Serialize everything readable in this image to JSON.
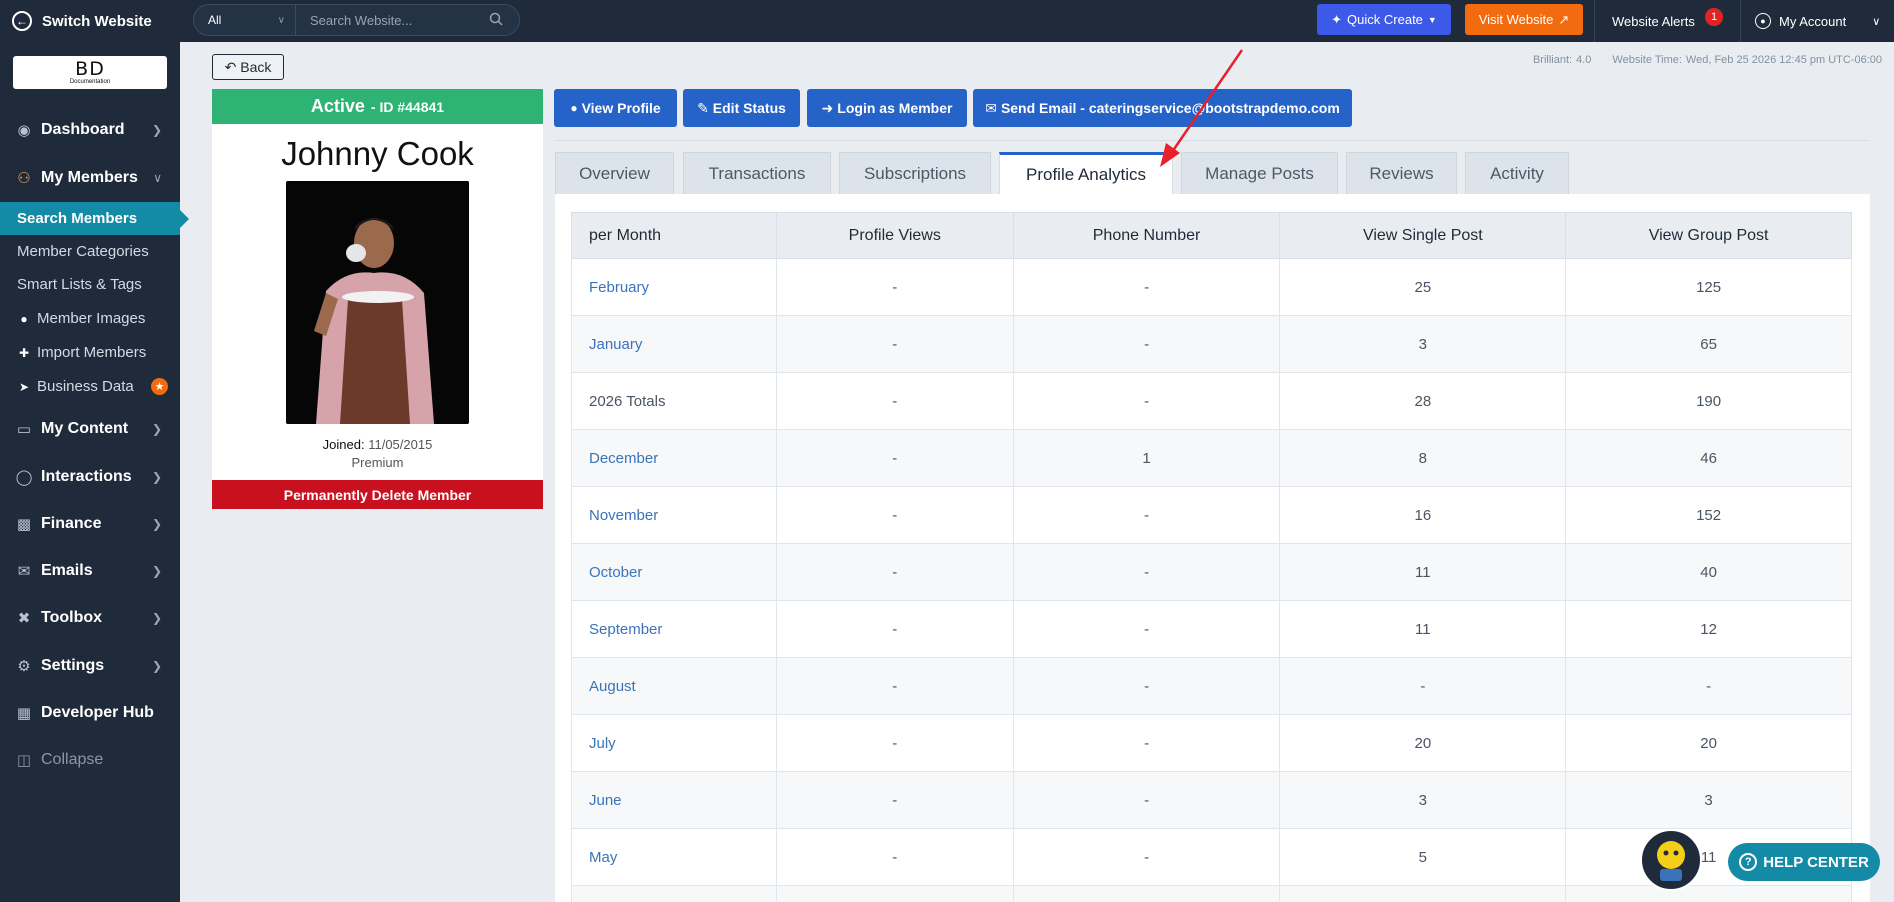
{
  "topbar": {
    "switch_label": "Switch Website",
    "search_scope": "All",
    "search_placeholder": "Search Website...",
    "quick_create": "Quick Create",
    "visit_website": "Visit Website",
    "alerts_label": "Website Alerts",
    "alerts_count": "1",
    "account_label": "My Account"
  },
  "sidebar": {
    "logo_text": "BD",
    "logo_sub": "Documentation",
    "nav": [
      {
        "label": "Dashboard",
        "icon": "speedometer-icon"
      },
      {
        "label": "My Members",
        "icon": "users-icon"
      },
      {
        "label": "My Content",
        "icon": "folder-icon"
      },
      {
        "label": "Interactions",
        "icon": "chat-icon"
      },
      {
        "label": "Finance",
        "icon": "bar-chart-icon"
      },
      {
        "label": "Emails",
        "icon": "email-icon"
      },
      {
        "label": "Toolbox",
        "icon": "tools-icon"
      },
      {
        "label": "Settings",
        "icon": "gear-icon"
      },
      {
        "label": "Developer Hub",
        "icon": "grid-icon"
      },
      {
        "label": "Collapse",
        "icon": "collapse-icon"
      }
    ],
    "members_sub": [
      {
        "label": "Search Members"
      },
      {
        "label": "Member Categories"
      },
      {
        "label": "Smart Lists & Tags"
      },
      {
        "label": "Member Images"
      },
      {
        "label": "Import Members"
      },
      {
        "label": "Business Data"
      }
    ]
  },
  "header": {
    "back_label": "Back",
    "brilliant_label": "Brilliant:",
    "brilliant_value": "4.0",
    "time_label": "Website Time:",
    "time_value": "Wed, Feb 25 2026 12:45 pm UTC-06:00"
  },
  "profile": {
    "status": "Active",
    "id_text": "- ID #44841",
    "name": "Johnny Cook",
    "joined_label": "Joined:",
    "joined_date": "11/05/2015",
    "plan": "Premium",
    "delete_label": "Permanently Delete Member"
  },
  "actions": {
    "view_profile": "View Profile",
    "edit_status": "Edit Status",
    "login_as": "Login as Member",
    "send_email": "Send Email - cateringservice@bootstrapdemo.com"
  },
  "tabs": [
    "Overview",
    "Transactions",
    "Subscriptions",
    "Profile Analytics",
    "Manage Posts",
    "Reviews",
    "Activity"
  ],
  "table": {
    "headers": [
      "per Month",
      "Profile Views",
      "Phone Number",
      "View Single Post",
      "View Group Post"
    ],
    "rows": [
      [
        "February",
        "-",
        "-",
        "25",
        "125"
      ],
      [
        "January",
        "-",
        "-",
        "3",
        "65"
      ],
      [
        "2026 Totals",
        "-",
        "-",
        "28",
        "190"
      ],
      [
        "December",
        "-",
        "1",
        "8",
        "46"
      ],
      [
        "November",
        "-",
        "-",
        "16",
        "152"
      ],
      [
        "October",
        "-",
        "-",
        "11",
        "40"
      ],
      [
        "September",
        "-",
        "-",
        "11",
        "12"
      ],
      [
        "August",
        "-",
        "-",
        "-",
        "-"
      ],
      [
        "July",
        "-",
        "-",
        "20",
        "20"
      ],
      [
        "June",
        "-",
        "-",
        "3",
        "3"
      ],
      [
        "May",
        "-",
        "-",
        "5",
        "11"
      ],
      [
        "",
        "",
        "",
        "",
        ""
      ]
    ]
  },
  "help": {
    "label": "HELP CENTER"
  },
  "colors": {
    "sidebar_bg": "#1f2b3a",
    "accent_blue": "#2563c9",
    "active_green": "#2fb374",
    "delete_red": "#c8101f",
    "teal": "#138aa6",
    "orange": "#f26b0f"
  }
}
